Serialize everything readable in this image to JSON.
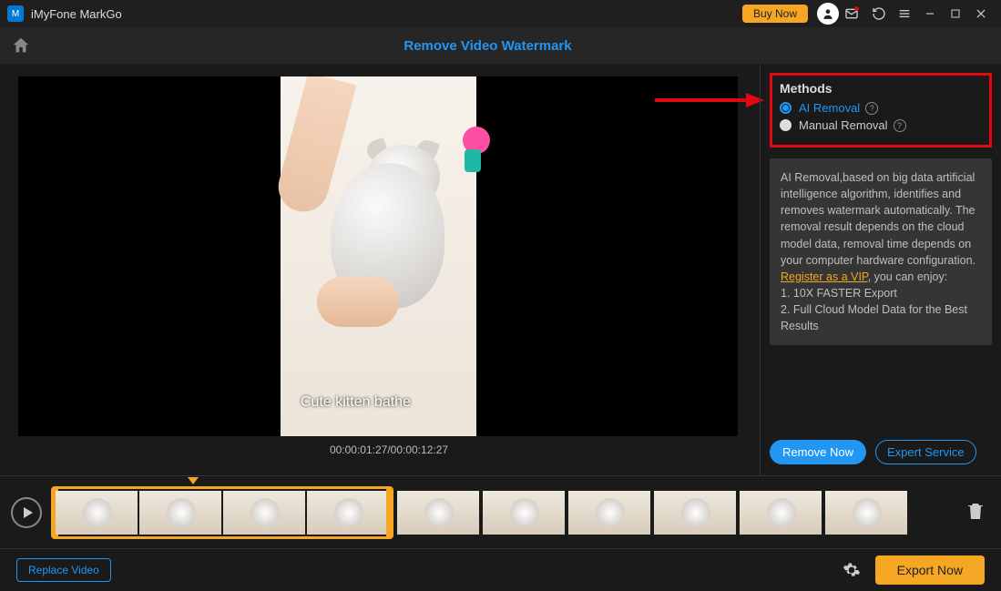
{
  "titlebar": {
    "app": "iMyFone MarkGo",
    "buy": "Buy Now"
  },
  "subheader": {
    "title": "Remove Video Watermark"
  },
  "video": {
    "watermark_text": "Cute kitten bathe",
    "timecode": "00:00:01:27/00:00:12:27"
  },
  "methods": {
    "heading": "Methods",
    "ai": "AI Removal",
    "manual": "Manual Removal"
  },
  "desc": {
    "p1": "AI Removal,based on big data artificial intelligence algorithm, identifies and removes watermark automatically. The removal result depends on the cloud model data, removal time depends on your computer hardware configuration. ",
    "vip": "Register as a VIP",
    "p2": ", you can enjoy:",
    "b1": "1. 10X FASTER Export",
    "b2": "2. Full Cloud Model Data for the Best Results"
  },
  "buttons": {
    "remove_now": "Remove Now",
    "expert_service": "Expert Service",
    "replace_video": "Replace Video",
    "export_now": "Export Now"
  }
}
